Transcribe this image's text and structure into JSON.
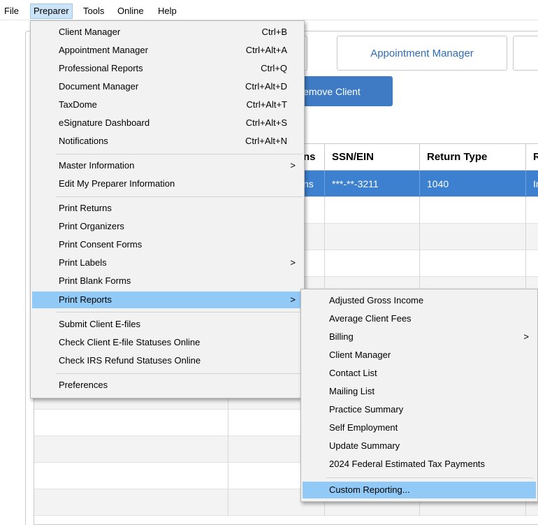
{
  "menubar": {
    "items": [
      "File",
      "Preparer",
      "Tools",
      "Online",
      "Help"
    ]
  },
  "background": {
    "tabs": [
      "Appointment Manager"
    ],
    "remove_button_label": "Remove Client",
    "grid_headers": [
      "ns",
      "SSN/EIN",
      "Return Type",
      "R"
    ],
    "selected_row": {
      "name_fragment": "ns",
      "ssn": "***-**-3211",
      "return_type": "1040",
      "last_fragment": "In"
    }
  },
  "preparer_menu": {
    "items": [
      {
        "label": "Client Manager",
        "shortcut": "Ctrl+B"
      },
      {
        "label": "Appointment Manager",
        "shortcut": "Ctrl+Alt+A"
      },
      {
        "label": "Professional Reports",
        "shortcut": "Ctrl+Q"
      },
      {
        "label": "Document Manager",
        "shortcut": "Ctrl+Alt+D"
      },
      {
        "label": "TaxDome",
        "shortcut": "Ctrl+Alt+T"
      },
      {
        "label": "eSignature Dashboard",
        "shortcut": "Ctrl+Alt+S"
      },
      {
        "label": "Notifications",
        "shortcut": "Ctrl+Alt+N"
      },
      {
        "label": "Master Information",
        "arrow": ">"
      },
      {
        "label": "Edit My Preparer Information"
      },
      {
        "label": "Print Returns"
      },
      {
        "label": "Print Organizers"
      },
      {
        "label": "Print Consent Forms"
      },
      {
        "label": "Print Labels",
        "arrow": ">"
      },
      {
        "label": "Print Blank Forms"
      },
      {
        "label": "Print Reports",
        "arrow": ">"
      },
      {
        "label": "Submit Client E-files"
      },
      {
        "label": "Check Client E-file Statuses Online"
      },
      {
        "label": "Check IRS Refund Statuses Online"
      },
      {
        "label": "Preferences"
      }
    ]
  },
  "reports_submenu": {
    "items": [
      {
        "label": "Adjusted Gross Income"
      },
      {
        "label": "Average Client Fees"
      },
      {
        "label": "Billing",
        "arrow": ">"
      },
      {
        "label": "Client Manager"
      },
      {
        "label": "Contact List"
      },
      {
        "label": "Mailing List"
      },
      {
        "label": "Practice Summary"
      },
      {
        "label": "Self Employment"
      },
      {
        "label": "Update Summary"
      },
      {
        "label": "2024 Federal Estimated Tax Payments"
      },
      {
        "label": "Custom Reporting..."
      }
    ]
  },
  "colors": {
    "highlight": "#91c9f7",
    "selected_row": "#3d80d0",
    "accent_button": "#3e7bc4",
    "tab_text": "#2e6cb8"
  }
}
